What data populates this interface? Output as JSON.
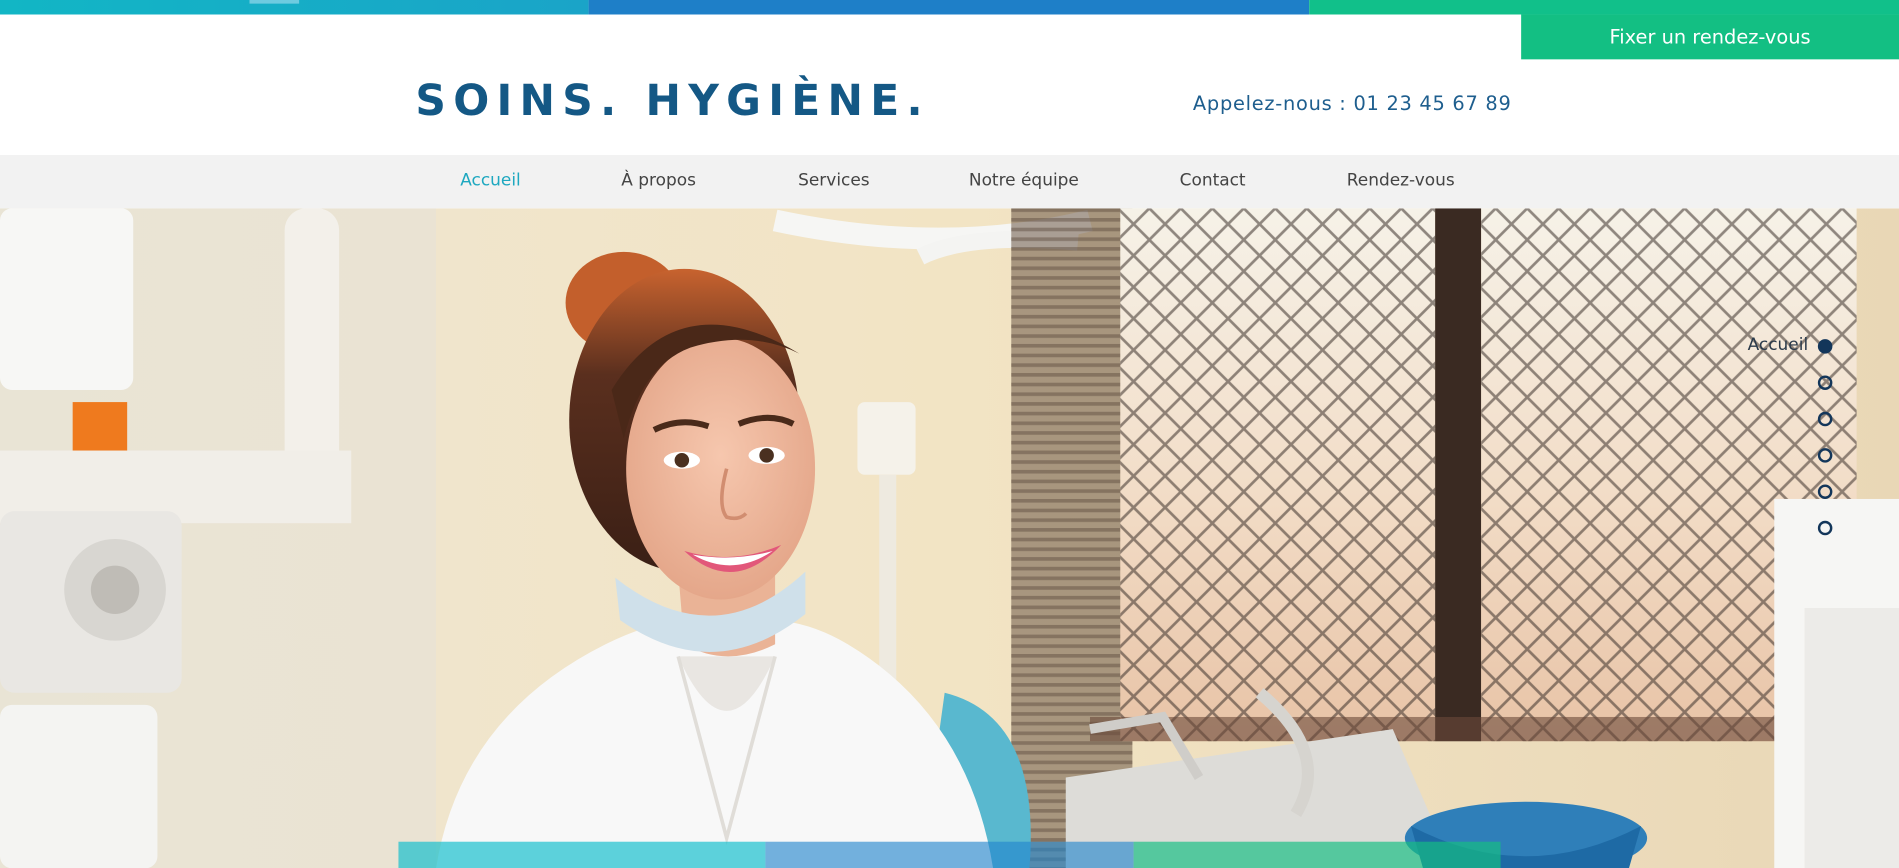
{
  "header": {
    "cta_label": "Fixer un rendez-vous",
    "logo_text": "SOINS. HYGIÈNE.",
    "phone_text": "Appelez-nous : 01 23 45 67 89"
  },
  "nav": {
    "items": [
      {
        "label": "Accueil",
        "active": true
      },
      {
        "label": "À propos"
      },
      {
        "label": "Services"
      },
      {
        "label": "Notre équipe"
      },
      {
        "label": "Contact"
      },
      {
        "label": "Rendez-vous"
      }
    ]
  },
  "side_nav": {
    "active_label": "Accueil",
    "active_index": 0,
    "dot_count": 6
  },
  "colors": {
    "brand_blue": "#145885",
    "cta_green": "#13bf83",
    "nav_active": "#1ea8c0",
    "nav_bg": "#f2f2f2"
  }
}
